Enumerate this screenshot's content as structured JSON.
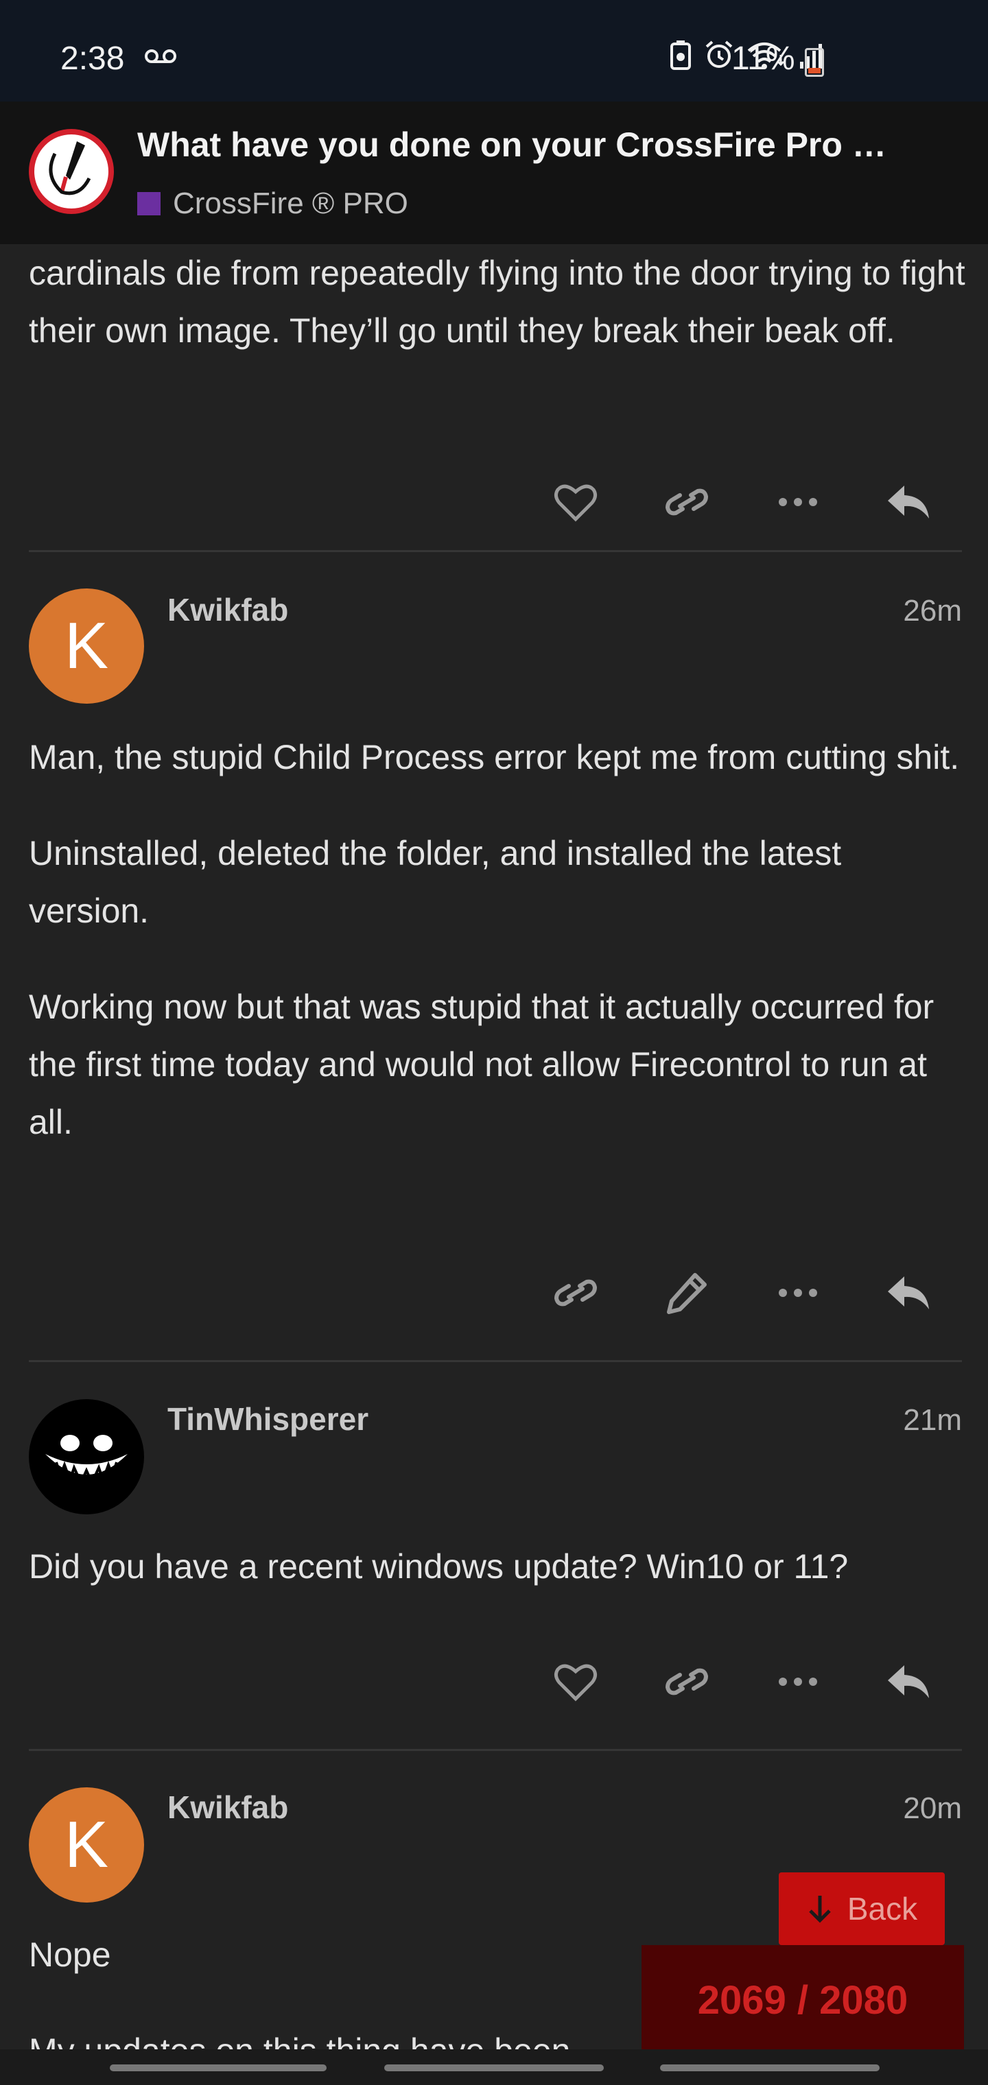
{
  "status_bar": {
    "time": "2:38",
    "battery_percent": "11%",
    "icons": [
      "voicemail-icon",
      "battery-saver-icon",
      "alarm-icon",
      "wifi-icon",
      "signal-icon",
      "battery-icon"
    ]
  },
  "topic": {
    "title": "What have you done on your CrossFire Pro …",
    "category": "CrossFire ® PRO",
    "category_color": "#6b2fa0"
  },
  "posts": [
    {
      "paragraphs": [
        "cardinals die from repeatedly flying into the door trying to fight their own image. They’ll go until they break their beak off."
      ],
      "actions": [
        "heart-icon",
        "link-icon",
        "more-icon",
        "reply-icon"
      ]
    },
    {
      "author": "Kwikfab",
      "avatar_letter": "K",
      "time": "26m",
      "paragraphs": [
        "Man, the stupid Child Process error kept me from cutting shit.",
        "Uninstalled, deleted the folder, and installed the latest version.",
        "Working now but that was stupid that it actually occurred for the first time today and would not allow Firecontrol to run at all."
      ],
      "actions": [
        "link-icon",
        "edit-icon",
        "more-icon",
        "reply-icon"
      ]
    },
    {
      "author": "TinWhisperer",
      "time": "21m",
      "paragraphs": [
        "Did you have a recent windows update? Win10 or 11?"
      ],
      "actions": [
        "heart-icon",
        "link-icon",
        "more-icon",
        "reply-icon"
      ]
    },
    {
      "author": "Kwikfab",
      "avatar_letter": "K",
      "time": "20m",
      "paragraphs": [
        "Nope",
        "My updates on this thing have been"
      ]
    }
  ],
  "controls": {
    "back_label": "Back",
    "progress": "2069 / 2080"
  },
  "colors": {
    "accent_red": "#c40e0e",
    "avatar_orange": "#d9772f",
    "background": "#222222"
  }
}
